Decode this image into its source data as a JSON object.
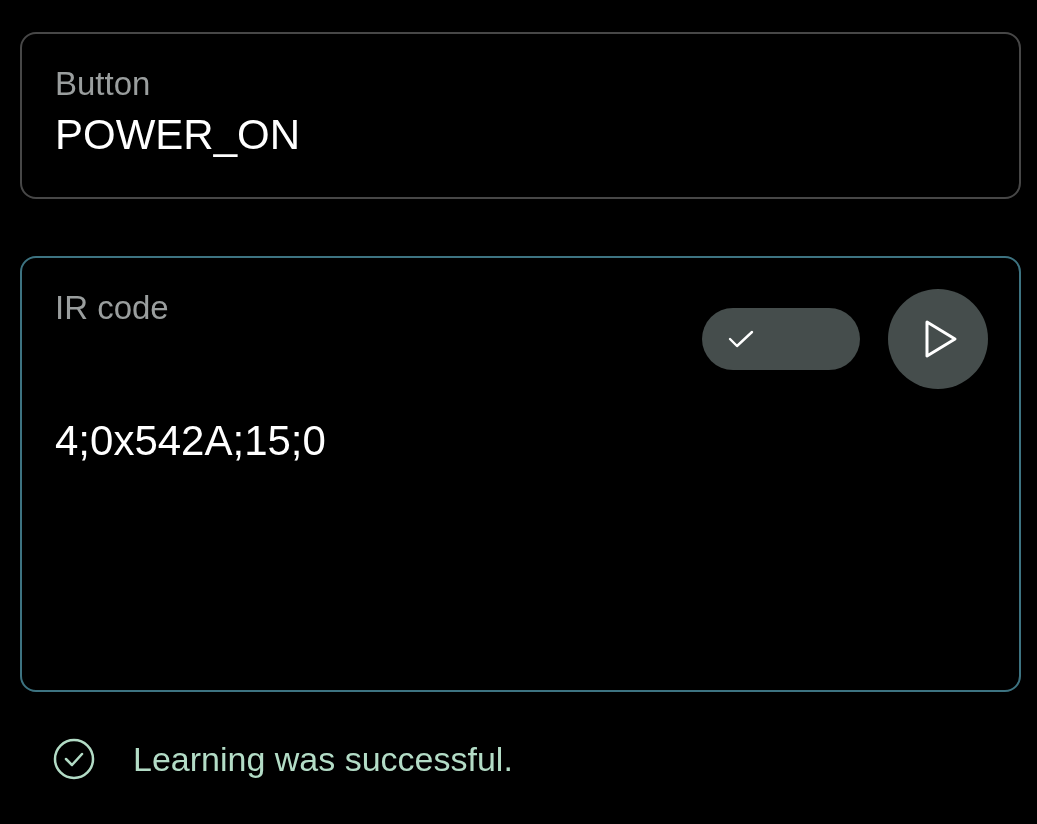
{
  "fields": [
    {
      "kind": "single",
      "label": "Button",
      "value": "POWER_ON",
      "focused": false
    },
    {
      "kind": "multi",
      "label": "IR code",
      "value": "4;0x542A;15;0",
      "focused": true,
      "chip": {
        "selected": true
      }
    }
  ],
  "status": {
    "kind": "success",
    "message": "Learning was successful."
  }
}
